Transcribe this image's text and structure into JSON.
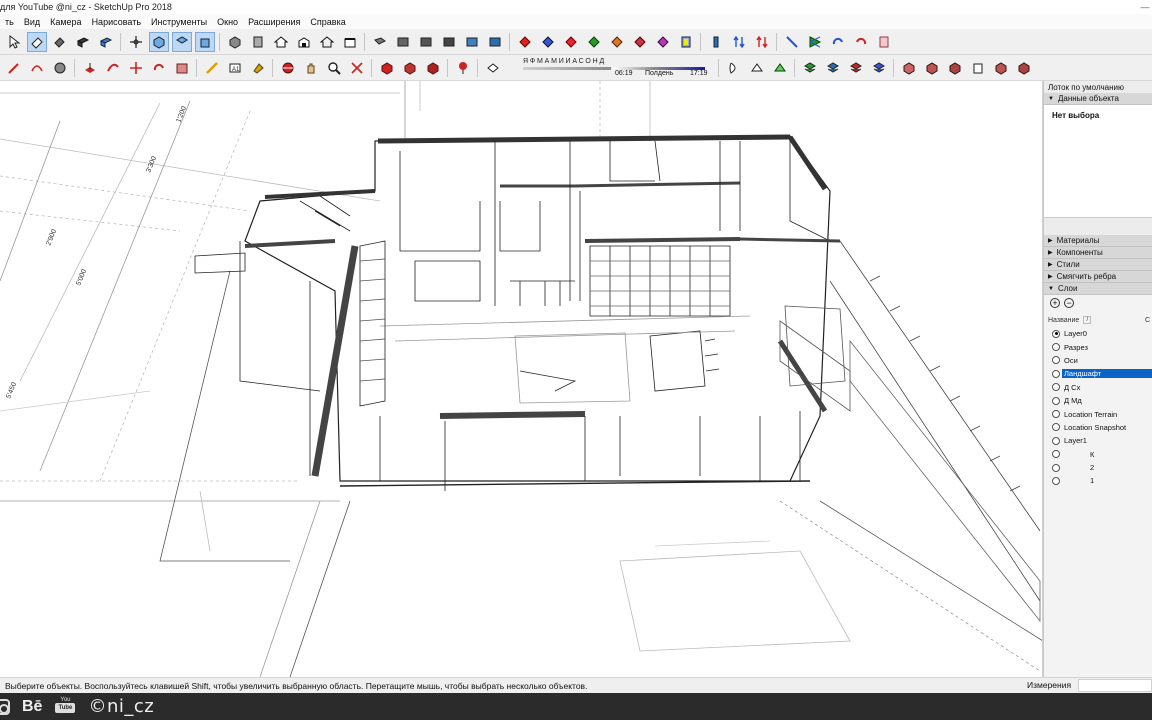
{
  "window": {
    "title": "для YouTube @ni_cz - SketchUp Pro 2018",
    "controls": [
      "—",
      "□",
      "✕"
    ]
  },
  "menu": {
    "items": [
      "ть",
      "Вид",
      "Камера",
      "Нарисовать",
      "Инструменты",
      "Окно",
      "Расширения",
      "Справка"
    ]
  },
  "toolbar_top": {
    "icons": [
      "select-arrow-icon",
      "eraser-icon",
      "paint-bucket-icon",
      "style-icon",
      "style-xray-icon",
      "orbit-icon",
      "view-iso-icon",
      "view-top-icon",
      "view-front-icon",
      "component-icon",
      "component-group-icon",
      "house-icon",
      "warehouse-icon",
      "house-outline-icon",
      "building-icon",
      "section-plane-icon",
      "section-a-icon",
      "section-b-icon",
      "section-c-icon",
      "section-d-icon",
      "section-e-icon",
      "axes-x-icon",
      "axes-red-icon",
      "axes-y-icon",
      "axes-green-icon",
      "axes-z-icon",
      "axes-blue-icon",
      "axes-purple-icon",
      "axes-magenta-icon",
      "measure-icon",
      "dimension-icon",
      "flip-icon",
      "flip-red-icon",
      "move-icon",
      "scale-icon",
      "rotate-cw-icon",
      "rotate-ccw-icon",
      "door-icon"
    ]
  },
  "toolbar_bottom": {
    "icons": [
      "pencil-icon",
      "arc-icon",
      "circle-icon",
      "push-pull-icon",
      "follow-me-icon",
      "move-arrows-icon",
      "rotate-icon",
      "offset-icon",
      "tape-measure-icon",
      "text-icon",
      "paint-icon",
      "orbit-tool-icon",
      "pan-icon",
      "zoom-icon",
      "zoom-extents-icon",
      "warehouse-3d-icon",
      "extension-warehouse-icon",
      "layout-icon",
      "pin-icon",
      "paper-icon"
    ],
    "shadow": {
      "months": "ЯФМАМИИАСОНД",
      "time_start": "06:19",
      "time_mid": "Полдень",
      "time_end": "17:19"
    },
    "icons_right": [
      "fog-icon",
      "sandbox-icon",
      "sandbox-from-scratch-icon",
      "layer-stack-icon",
      "layer-red-icon",
      "layer-green-icon",
      "layer-blue-icon",
      "solid-tools-icon",
      "solid-union-icon",
      "solid-subtract-icon",
      "solid-trim-icon",
      "solid-split-icon",
      "solid-intersect-icon",
      "solid-outer-icon"
    ]
  },
  "tray": {
    "title": "Лоток по умолчанию",
    "entity_panel": "Данные объекта",
    "entity_value": "Нет выбора",
    "panels": [
      "Материалы",
      "Компоненты",
      "Стили",
      "Смягчить ребра",
      "Слои"
    ],
    "layers_header": "Название",
    "layers_header_right": "C",
    "layers": [
      {
        "name": "Layer0",
        "active": true,
        "selected": false,
        "indented": false
      },
      {
        "name": "Разрез",
        "active": false,
        "selected": false,
        "indented": false
      },
      {
        "name": "Оси",
        "active": false,
        "selected": false,
        "indented": false
      },
      {
        "name": "Ландшафт",
        "active": false,
        "selected": true,
        "indented": false
      },
      {
        "name": "Д Сх",
        "active": false,
        "selected": false,
        "indented": false
      },
      {
        "name": "Д Мд",
        "active": false,
        "selected": false,
        "indented": false
      },
      {
        "name": "Location Terrain",
        "active": false,
        "selected": false,
        "indented": false
      },
      {
        "name": "Location Snapshot",
        "active": false,
        "selected": false,
        "indented": false
      },
      {
        "name": "Layer1",
        "active": false,
        "selected": false,
        "indented": false
      },
      {
        "name": "К",
        "active": false,
        "selected": false,
        "indented": true
      },
      {
        "name": "2",
        "active": false,
        "selected": false,
        "indented": true
      },
      {
        "name": "1",
        "active": false,
        "selected": false,
        "indented": true
      }
    ]
  },
  "status": {
    "text": "Выберите объекты. Воспользуйтесь клавишей Shift, чтобы увеличить выбранную область. Перетащите мышь, чтобы выбрать несколько объектов.",
    "measure_label": "Измерения",
    "measure_value": ""
  },
  "watermark": {
    "be": "Bē",
    "yt_label": "You",
    "yt_box": "Tube",
    "handle": "©ni_cz"
  },
  "viewport": {
    "dimension_labels": [
      "1'200",
      "3'300",
      "2'900",
      "5'000",
      "5'450"
    ]
  }
}
